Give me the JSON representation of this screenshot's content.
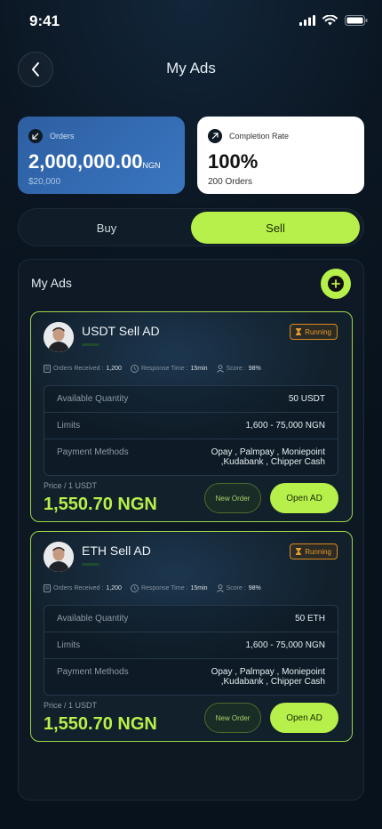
{
  "status_bar": {
    "time": "9:41"
  },
  "header": {
    "title": "My Ads"
  },
  "stats": {
    "orders": {
      "label": "Orders",
      "value": "2,000,000.00",
      "unit": "NGN",
      "sub": "$20,000"
    },
    "completion": {
      "label": "Completion Rate",
      "value": "100%",
      "sub": "200 Orders"
    }
  },
  "toggle": {
    "buy_label": "Buy",
    "sell_label": "Sell",
    "selected": "Sell"
  },
  "panel": {
    "title": "My Ads"
  },
  "ads": [
    {
      "title": "USDT Sell AD",
      "status": "Running",
      "orders_label": "Orders Received :",
      "orders_value": "1,200",
      "response_label": "Response Time :",
      "response_value": "15min",
      "score_label": "Score :",
      "score_value": "98%",
      "details": [
        {
          "key": "Available Quantity",
          "value": "50 USDT"
        },
        {
          "key": "Limits",
          "value": "1,600 - 75,000 NGN"
        },
        {
          "key": "Payment Methods",
          "value_line1": "Opay , Palmpay , Moniepoint",
          "value_line2": ",Kudabank , Chipper Cash"
        }
      ],
      "price_label": "Price / 1 USDT",
      "price_value": "1,550.70 NGN",
      "new_order_label": "New Order",
      "open_ad_label": "Open AD"
    },
    {
      "title": "ETH Sell AD",
      "status": "Running",
      "orders_label": "Orders Received :",
      "orders_value": "1,200",
      "response_label": "Response Time :",
      "response_value": "15min",
      "score_label": "Score :",
      "score_value": "98%",
      "details": [
        {
          "key": "Available Quantity",
          "value": "50 ETH"
        },
        {
          "key": "Limits",
          "value": "1,600 - 75,000 NGN"
        },
        {
          "key": "Payment Methods",
          "value_line1": "Opay , Palmpay , Moniepoint",
          "value_line2": ",Kudabank , Chipper Cash"
        }
      ],
      "price_label": "Price / 1 USDT",
      "price_value": "1,550.70 NGN",
      "new_order_label": "New Order",
      "open_ad_label": "Open AD"
    }
  ],
  "colors": {
    "accent": "#b7f04a",
    "running": "#e89a2c",
    "orders_card": "#3a76c0"
  }
}
